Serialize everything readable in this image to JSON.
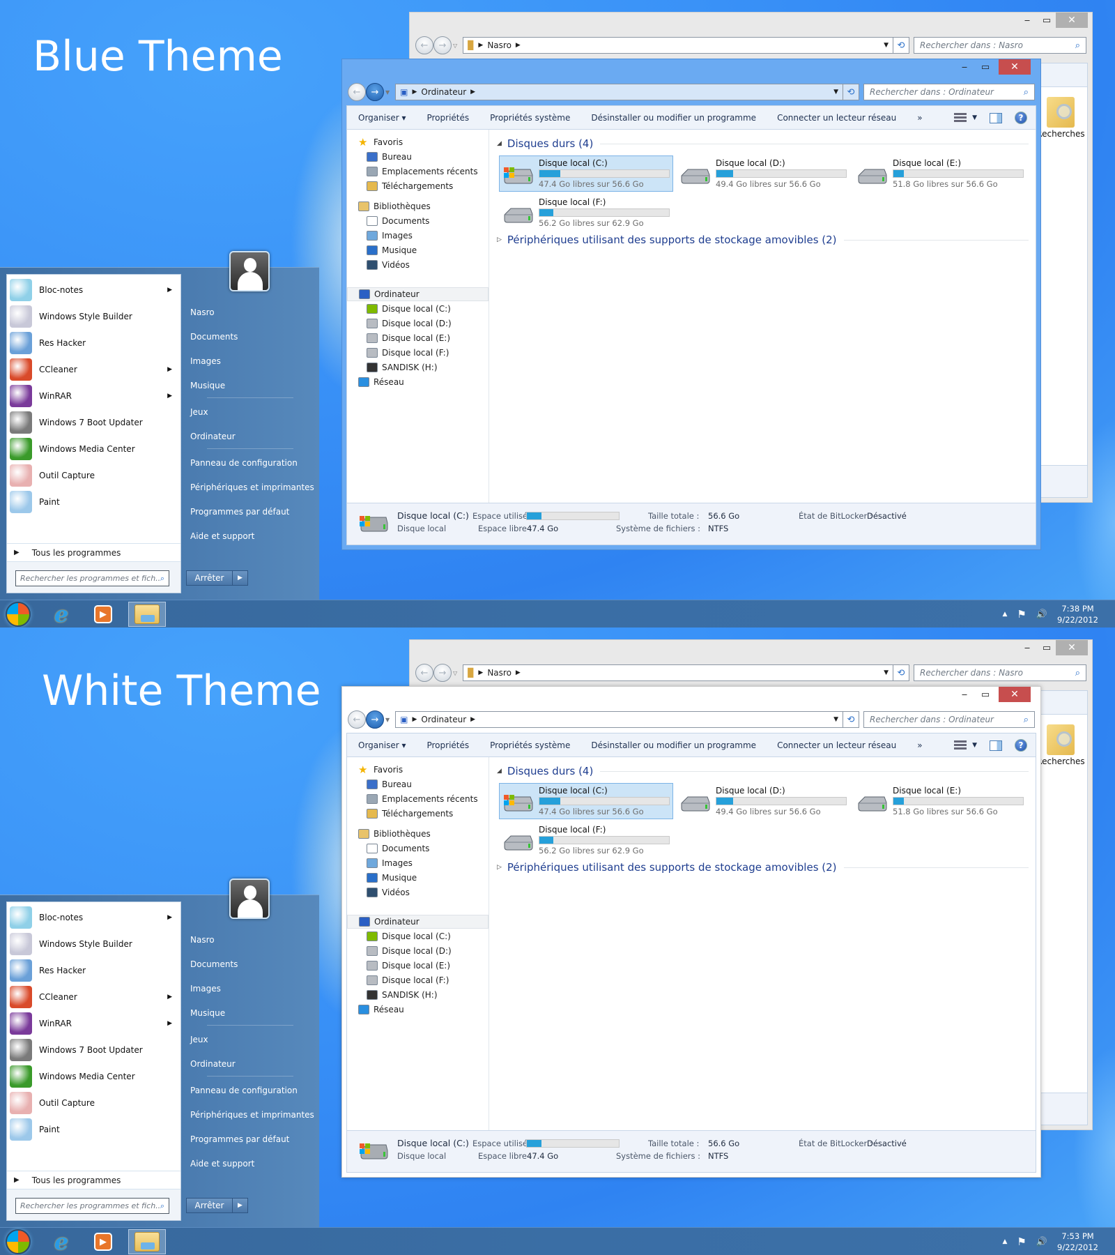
{
  "panels": [
    {
      "theme_title": "Blue Theme",
      "clock": {
        "time": "7:38 PM",
        "date": "9/22/2012"
      }
    },
    {
      "theme_title": "White Theme",
      "clock": {
        "time": "7:53 PM",
        "date": "9/22/2012"
      }
    }
  ],
  "themes": {
    "blue": {
      "frame": "#6aaaf2",
      "frame_border": "#4f8ed8",
      "close": "#c74e4e"
    },
    "white": {
      "frame": "#ffffff",
      "frame_border": "#c9c9c9",
      "close": "#c74e4e"
    },
    "inactive": {
      "frame": "#e9e9e9",
      "close": "#b0b0b0"
    }
  },
  "back_window": {
    "address": {
      "crumbs": [
        "Nasro"
      ]
    },
    "search_placeholder": "Rechercher dans : Nasro",
    "folder": {
      "label": "Recherches",
      "icon": "search-folder-icon"
    },
    "caption": {
      "minimize": "‒",
      "maximize": "▭",
      "close": "✕"
    }
  },
  "explorer": {
    "caption": {
      "minimize": "‒",
      "maximize": "▭",
      "close": "✕"
    },
    "address": {
      "crumbs": [
        "Ordinateur"
      ]
    },
    "search_placeholder": "Rechercher dans : Ordinateur",
    "commands": [
      "Organiser ▾",
      "Propriétés",
      "Propriétés système",
      "Désinstaller ou modifier un programme",
      "Connecter un lecteur réseau",
      "»"
    ],
    "nav": {
      "favorites": {
        "label": "Favoris",
        "items": [
          "Bureau",
          "Emplacements récents",
          "Téléchargements"
        ]
      },
      "libraries": {
        "label": "Bibliothèques",
        "items": [
          "Documents",
          "Images",
          "Musique",
          "Vidéos"
        ]
      },
      "computer": {
        "label": "Ordinateur",
        "items": [
          "Disque local (C:)",
          "Disque local (D:)",
          "Disque local (E:)",
          "Disque local (F:)",
          "SANDISK (H:)"
        ]
      },
      "network": {
        "label": "Réseau"
      }
    },
    "groups": {
      "hard_disks": "Disques durs (4)",
      "removable": "Périphériques utilisant des supports de stockage amovibles (2)"
    },
    "drives": [
      {
        "name": "Disque local (C:)",
        "free_text": "47.4 Go libres sur 56.6 Go",
        "used_fraction": 0.16,
        "selected": true,
        "system": true
      },
      {
        "name": "Disque local (D:)",
        "free_text": "49.4 Go libres sur 56.6 Go",
        "used_fraction": 0.13,
        "selected": false,
        "system": false
      },
      {
        "name": "Disque local (E:)",
        "free_text": "51.8 Go libres sur 56.6 Go",
        "used_fraction": 0.08,
        "selected": false,
        "system": false
      },
      {
        "name": "Disque local (F:)",
        "free_text": "56.2 Go libres sur 62.9 Go",
        "used_fraction": 0.11,
        "selected": false,
        "system": false
      }
    ],
    "details": {
      "name": "Disque local (C:)",
      "type": "Disque local",
      "used_label": "Espace utilisé :",
      "used_fraction": 0.16,
      "free_label": "Espace libre :",
      "free_value": "47.4 Go",
      "total_label": "Taille totale :",
      "total_value": "56.6 Go",
      "fs_label": "Système de fichiers :",
      "fs_value": "NTFS",
      "bitlocker_label": "État de BitLocker :",
      "bitlocker_value": "Désactivé"
    }
  },
  "start_menu": {
    "programs": [
      {
        "label": "Bloc-notes",
        "submenu": true,
        "icon": "notepad-icon",
        "color": "#8fd0e8"
      },
      {
        "label": "Windows Style Builder",
        "submenu": false,
        "icon": "style-builder-icon",
        "color": "#c8c8d8"
      },
      {
        "label": "Res Hacker",
        "submenu": false,
        "icon": "res-hacker-icon",
        "color": "#6aa0d8"
      },
      {
        "label": "CCleaner",
        "submenu": true,
        "icon": "ccleaner-icon",
        "color": "#d94a2a"
      },
      {
        "label": "WinRAR",
        "submenu": true,
        "icon": "winrar-icon",
        "color": "#7a3a9a"
      },
      {
        "label": "Windows 7 Boot Updater",
        "submenu": false,
        "icon": "boot-updater-icon",
        "color": "#7a7a7a"
      },
      {
        "label": "Windows Media Center",
        "submenu": false,
        "icon": "media-center-icon",
        "color": "#3a9a2a"
      },
      {
        "label": "Outil Capture",
        "submenu": false,
        "icon": "snipping-tool-icon",
        "color": "#e8b0b0"
      },
      {
        "label": "Paint",
        "submenu": false,
        "icon": "paint-icon",
        "color": "#9cc8ea"
      }
    ],
    "all_programs": "Tous les programmes",
    "search_placeholder": "Rechercher les programmes et fich...",
    "right_items": [
      "Nasro",
      "Documents",
      "Images",
      "Musique",
      "Jeux",
      "Ordinateur",
      "Panneau de configuration",
      "Périphériques et imprimantes",
      "Programmes par défaut",
      "Aide et support"
    ],
    "shutdown": "Arrêter"
  },
  "taskbar": {
    "apps": [
      {
        "name": "internet-explorer",
        "glyph": "e",
        "active": false
      },
      {
        "name": "media-player",
        "glyph": "▶",
        "active": false
      },
      {
        "name": "file-explorer",
        "glyph": "🗀",
        "active": true
      }
    ],
    "tray": {
      "show_hidden": "▲",
      "flag": "⚑",
      "volume": "🔊"
    }
  }
}
